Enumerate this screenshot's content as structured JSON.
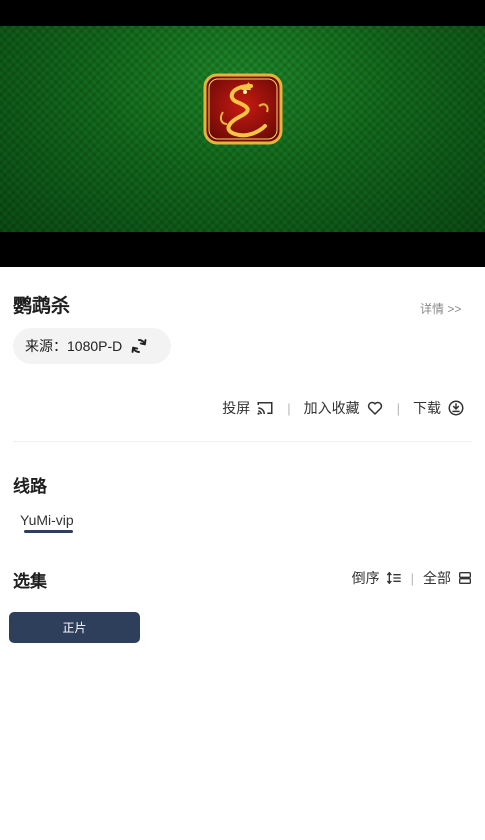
{
  "video": {
    "logo_icon": "dragon-emblem-icon"
  },
  "info": {
    "title": "鹦鹉杀",
    "details_link": "详情 >>",
    "source_label": "来源：1080P-D"
  },
  "actions": {
    "cast_label": "投屏",
    "sep1": "|",
    "favorite_label": "加入收藏",
    "sep2": "|",
    "download_label": "下载"
  },
  "routes": {
    "heading": "线路",
    "items": [
      {
        "label": "YuMi-vip",
        "selected": true
      }
    ]
  },
  "episodes": {
    "heading": "选集",
    "reverse_label": "倒序",
    "sep": "|",
    "all_label": "全部",
    "items": [
      {
        "label": "正片"
      }
    ]
  },
  "colors": {
    "accent": "#2e3f5c",
    "video_green": "#136a1d"
  }
}
